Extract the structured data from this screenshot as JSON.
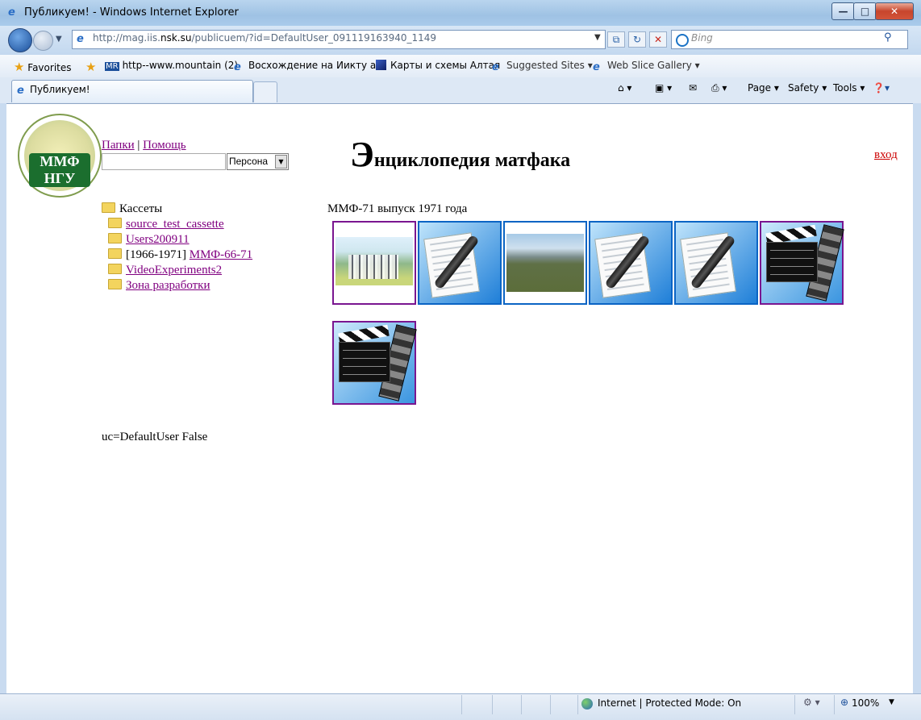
{
  "window": {
    "title": "Публикуем! - Windows Internet Explorer",
    "min": "—",
    "max": "□",
    "close": "✕"
  },
  "nav": {
    "address_prefix": "http://mag.iis.",
    "address_host": "nsk.su",
    "address_suffix": "/publicuem/?id=DefaultUser_091119163940_1149",
    "search_placeholder": "Bing"
  },
  "favorites": {
    "label": "Favorites",
    "items": [
      "http--www.mountain (2)",
      "Восхождение на Иикту а...",
      "Карты и схемы Алтая",
      "Suggested Sites ▾",
      "Web Slice Gallery ▾"
    ]
  },
  "tab": {
    "label": "Публикуем!"
  },
  "commands": {
    "page": "Page ▾",
    "safety": "Safety ▾",
    "tools": "Tools ▾"
  },
  "status": {
    "zone": "Internet | Protected Mode: On",
    "zoom": "100%"
  },
  "page": {
    "links": {
      "folders": "Папки",
      "separator": "|",
      "help": "Помощь"
    },
    "select_value": "Персона",
    "title_first": "Э",
    "title_rest": "нциклопедия матфака",
    "login": "вход",
    "tree": {
      "root": "Кассеты",
      "items": [
        {
          "label": "source_test_cassette"
        },
        {
          "label": "Users200911"
        },
        {
          "prefix": "[1966-1971]",
          "label": "ММФ-66-71"
        },
        {
          "label": "VideoExperiments2"
        },
        {
          "label": "Зона разработки"
        }
      ]
    },
    "section_title": "ММФ-71 выпуск 1971 года",
    "footer": "uc=DefaultUser False",
    "logo_text": "ММФ НГУ"
  }
}
